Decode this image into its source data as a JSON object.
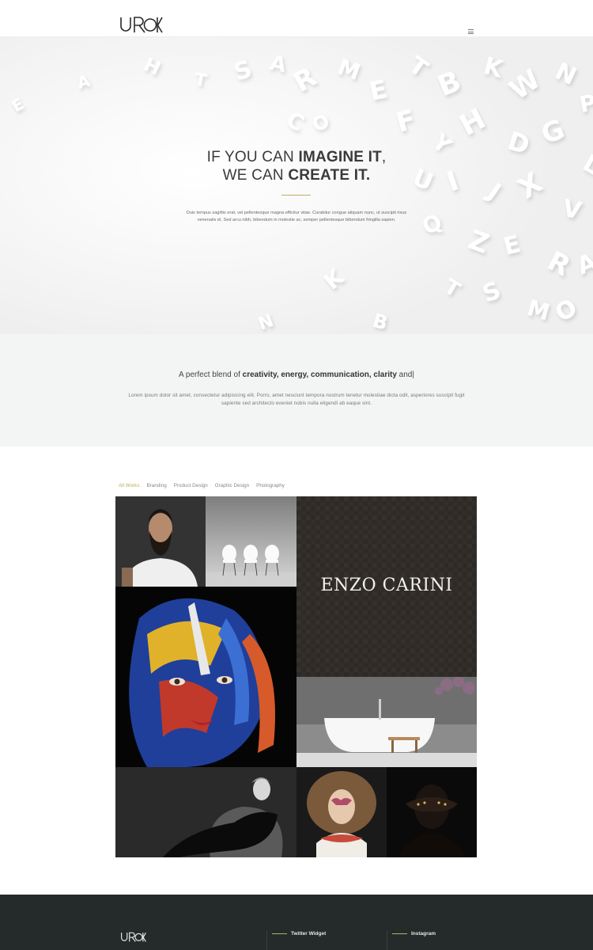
{
  "header": {
    "logo_text": "UROK",
    "menu_icon": "hamburger-icon"
  },
  "hero": {
    "title_line1_normal": "IF YOU CAN ",
    "title_line1_bold": "IMAGINE IT",
    "title_line1_end": ",",
    "title_line2_normal": "WE CAN ",
    "title_line2_bold": "CREATE IT.",
    "text": "Duis tempus sagittis erat, vel pellentesque magna efficitur vitae. Curabitur congue aliquam nunc, ut suscipit risus venenatis id. Sed arcu nibh, bibendum in molestie ac, semper pellentesque bibendum fringilla sapien.",
    "accent_color": "#b9b06a"
  },
  "blend": {
    "title_normal": "A perfect blend of ",
    "title_bold": "creativity, energy, communication, clarity",
    "title_end": " and|",
    "text": "Lorem ipsum dolor sit amet, consectetur adipisicing elit. Porro, amet nesciunt tempora nostrum tenetur molestiae dicta odit, asperiores suscipit fugit sapiente sed architecto eveniet nobis nulla eligendi ab eaque sint."
  },
  "portfolio": {
    "filters": [
      "All Works",
      "Branding",
      "Product Design",
      "Graphic Design",
      "Photography"
    ],
    "active_filter": "All Works",
    "active_color": "#bfae52",
    "brand_tile_text": "ENZO CARINI"
  },
  "footer": {
    "logo_text": "UROK",
    "widget1": "Twitter Widget",
    "widget2": "Instagram",
    "bg_color": "#252a2b"
  }
}
